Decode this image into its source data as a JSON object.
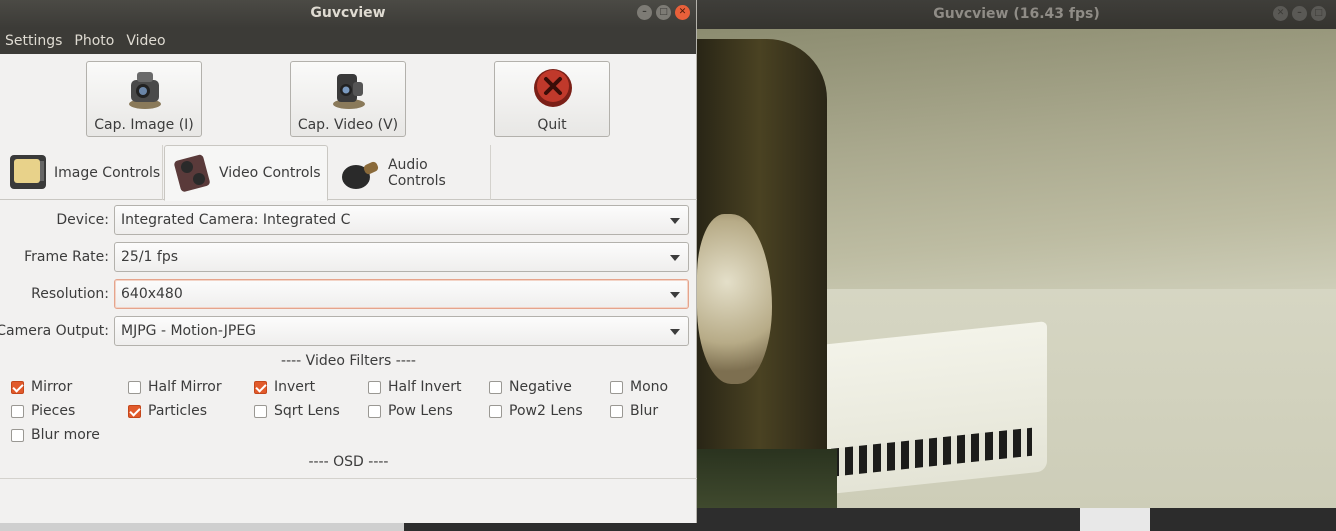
{
  "control_window": {
    "title": "Guvcview",
    "menu": [
      "Settings",
      "Photo",
      "Video"
    ],
    "capture_buttons": {
      "image": "Cap. Image (I)",
      "video": "Cap. Video (V)",
      "quit": "Quit"
    },
    "tabs": [
      "Image Controls",
      "Video Controls",
      "Audio Controls"
    ],
    "active_tab": "Video Controls",
    "fields": {
      "device": {
        "label": "Device:",
        "value": "Integrated Camera: Integrated C"
      },
      "frame_rate": {
        "label": "Frame Rate:",
        "value": "25/1 fps"
      },
      "resolution": {
        "label": "Resolution:",
        "value": "640x480"
      },
      "camera_output": {
        "label": "Camera Output:",
        "value": "MJPG - Motion-JPEG"
      }
    },
    "video_filters_title": "---- Video Filters ----",
    "filters": [
      {
        "label": "Mirror",
        "checked": true
      },
      {
        "label": "Half Mirror",
        "checked": false
      },
      {
        "label": "Invert",
        "checked": true
      },
      {
        "label": "Half Invert",
        "checked": false
      },
      {
        "label": "Negative",
        "checked": false
      },
      {
        "label": "Mono",
        "checked": false
      },
      {
        "label": "Pieces",
        "checked": false
      },
      {
        "label": "Particles",
        "checked": true
      },
      {
        "label": "Sqrt Lens",
        "checked": false
      },
      {
        "label": "Pow Lens",
        "checked": false
      },
      {
        "label": "Pow2 Lens",
        "checked": false
      },
      {
        "label": "Blur",
        "checked": false
      },
      {
        "label": "Blur more",
        "checked": false
      }
    ],
    "osd_title": "---- OSD ----"
  },
  "preview_window": {
    "title": "Guvcview  (16.43 fps)"
  },
  "colors": {
    "accent": "#e15a2b",
    "titlebar": "#3c3b37",
    "window_bg": "#f2f1f0"
  }
}
